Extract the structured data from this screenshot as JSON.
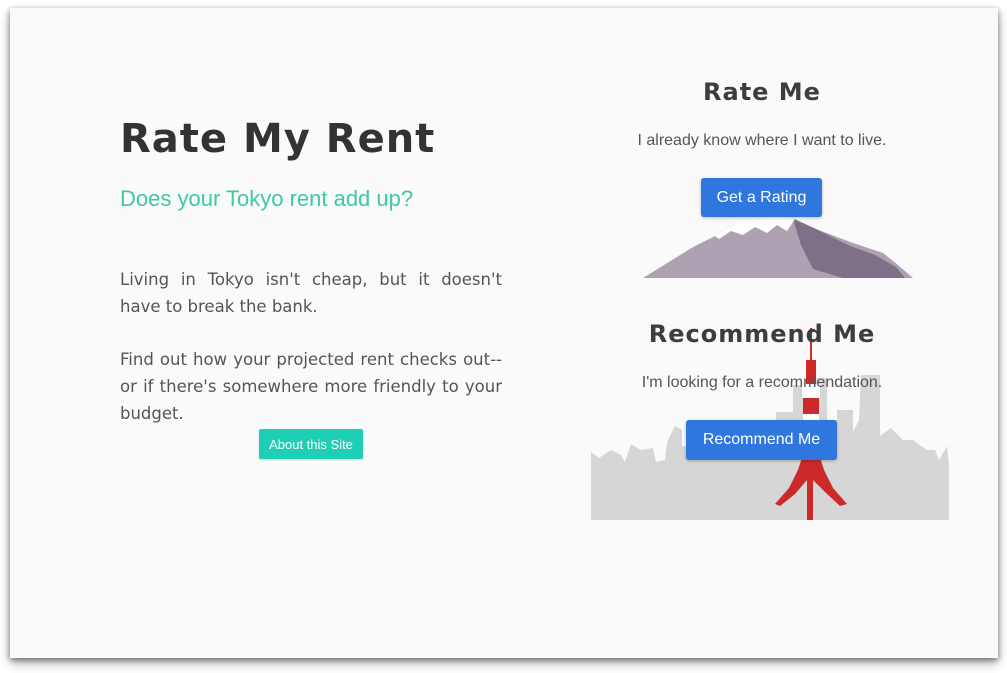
{
  "hero": {
    "title": "Rate My Rent",
    "tagline": "Does your Tokyo rent add up?",
    "paragraph_1": "Living in Tokyo isn't cheap, but it doesn't have to break the bank.",
    "paragraph_2": "Find out how your projected rent checks out--or if there's somewhere more friendly to your budget.",
    "about_button": "About this Site"
  },
  "rate_card": {
    "title": "Rate Me",
    "description": "I already know where I want to live.",
    "button": "Get a Rating"
  },
  "recommend_card": {
    "title": "Recommend Me",
    "description": "I'm looking for a recommendation.",
    "button": "Recommend Me"
  },
  "colors": {
    "title_text": "#333333",
    "tagline": "#3cc9a4",
    "about_button_bg": "#1fcfb5",
    "primary_button_bg": "#2f76de",
    "mountain": "#aea2b2",
    "mountain_shadow": "#7d7087",
    "skyline": "#d6d6d6",
    "tower_red": "#cc2929"
  },
  "icons": {
    "mountain": "mountain-illustration",
    "skyline": "city-skyline-illustration",
    "tower": "tokyo-tower-illustration"
  }
}
